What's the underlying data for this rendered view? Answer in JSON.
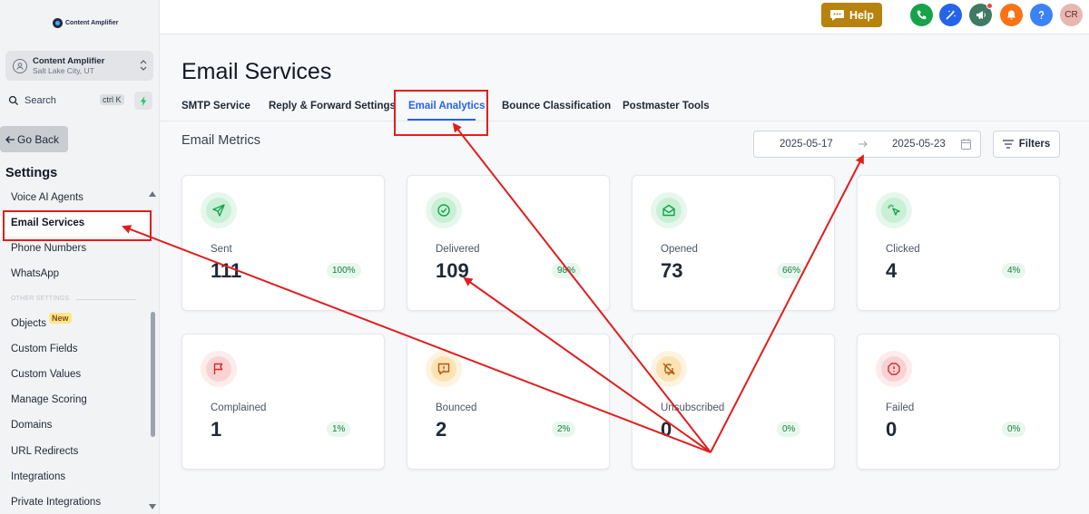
{
  "logo": {
    "text": "Content Amplifier"
  },
  "account": {
    "name": "Content Amplifier",
    "location": "Salt Lake City, UT"
  },
  "search": {
    "label": "Search",
    "shortcut": "ctrl K"
  },
  "nav": {
    "go_back": "Go Back",
    "settings_title": "Settings",
    "items": [
      "Voice AI Agents",
      "Email Services",
      "Phone Numbers",
      "WhatsApp",
      "Objects",
      "Custom Fields",
      "Custom Values",
      "Manage Scoring",
      "Domains",
      "URL Redirects",
      "Integrations",
      "Private Integrations"
    ],
    "other_settings_label": "OTHER SETTINGS",
    "new_badge": "New",
    "active_item": "Email Services"
  },
  "topbar": {
    "help_label": "Help",
    "avatar_initials": "CR"
  },
  "page": {
    "title": "Email Services",
    "tabs": [
      "SMTP Service",
      "Reply & Forward Settings",
      "Email Analytics",
      "Bounce Classification",
      "Postmaster Tools"
    ],
    "active_tab": "Email Analytics",
    "section_title": "Email Metrics",
    "date_start": "2025-05-17",
    "date_end": "2025-05-23",
    "filters_label": "Filters"
  },
  "metrics": [
    {
      "label": "Sent",
      "value": "111",
      "percent": "100%",
      "icon": "send-icon",
      "tone": "green"
    },
    {
      "label": "Delivered",
      "value": "109",
      "percent": "98%",
      "icon": "check-circle-icon",
      "tone": "green"
    },
    {
      "label": "Opened",
      "value": "73",
      "percent": "66%",
      "icon": "mail-open-icon",
      "tone": "green"
    },
    {
      "label": "Clicked",
      "value": "4",
      "percent": "4%",
      "icon": "pointer-click-icon",
      "tone": "green"
    },
    {
      "label": "Complained",
      "value": "1",
      "percent": "1%",
      "icon": "flag-icon",
      "tone": "red"
    },
    {
      "label": "Bounced",
      "value": "2",
      "percent": "2%",
      "icon": "alert-message-icon",
      "tone": "amber"
    },
    {
      "label": "Unsubscribed",
      "value": "0",
      "percent": "0%",
      "icon": "bell-off-icon",
      "tone": "amber"
    },
    {
      "label": "Failed",
      "value": "0",
      "percent": "0%",
      "icon": "alert-octagon-icon",
      "tone": "red"
    }
  ],
  "colors": {
    "accent": "#2563eb",
    "annotation": "#e01e1e",
    "help_button": "#b7820d"
  }
}
